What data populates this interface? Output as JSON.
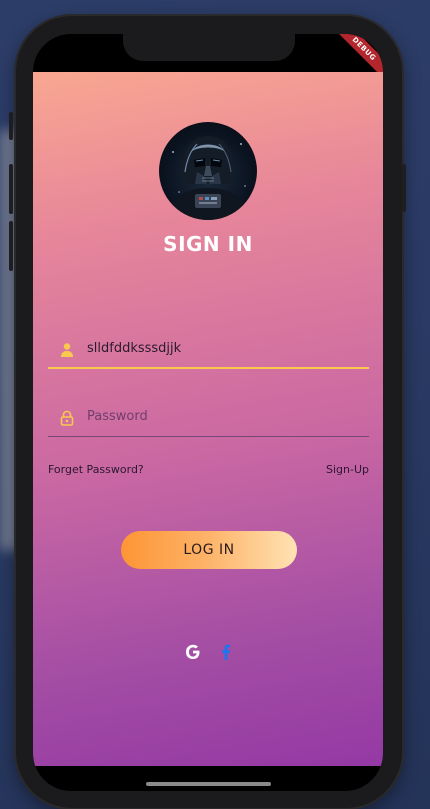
{
  "banner": {
    "debug_label": "DEBUG"
  },
  "login": {
    "title": "SIGN IN",
    "username": {
      "value": "slldfddksssdjjk"
    },
    "password": {
      "placeholder": "Password"
    },
    "forgot_link": "Forget Password?",
    "signup_link": "Sign-Up",
    "login_button": "LOG IN"
  },
  "social": {
    "google_glyph": "G",
    "facebook_glyph": "f"
  },
  "colors": {
    "gradient_top": "#f9a791",
    "gradient_bottom": "#9439a4",
    "accent": "#f9c94e",
    "button_start": "#fd9535",
    "button_end": "#ffe2b4",
    "facebook_blue": "#1877f2"
  },
  "icons": [
    "avatar-image",
    "person-icon",
    "lock-icon",
    "google-icon",
    "facebook-icon"
  ]
}
